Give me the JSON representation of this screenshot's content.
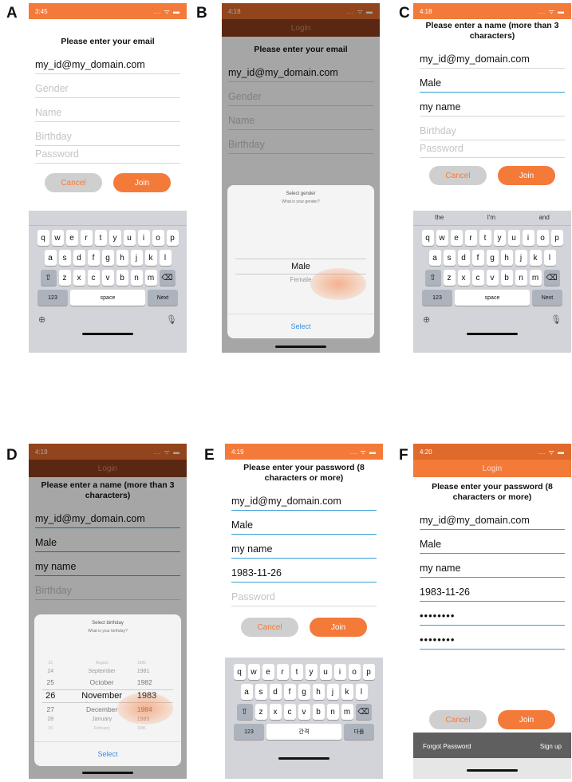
{
  "labels": {
    "a": "A",
    "b": "B",
    "c": "C",
    "d": "D",
    "e": "E",
    "f": "F"
  },
  "status_times": {
    "a": "3:45",
    "b": "4:18",
    "c": "4:18",
    "d": "4:19",
    "e": "4:19",
    "f": "4:20"
  },
  "status_icons": "... ᯤ ▬",
  "nav_title": "Login",
  "prompts": {
    "email": "Please enter your email",
    "name": "Please enter a name (more than 3 characters)",
    "password": "Please enter your password (8 characters or more)"
  },
  "placeholders": {
    "gender": "Gender",
    "name": "Name",
    "birthday": "Birthday",
    "password": "Password"
  },
  "values": {
    "email": "my_id@my_domain.com",
    "gender": "Male",
    "name": "my name",
    "birthday": "1983-11-26",
    "password_mask": "••••••••"
  },
  "buttons": {
    "cancel": "Cancel",
    "join": "Join",
    "select": "Select",
    "forgot": "Forgot Password",
    "signup": "Sign up"
  },
  "gender_picker": {
    "title": "Select gender",
    "subtitle": "What is your gender?",
    "options": [
      "Male",
      "Female"
    ]
  },
  "birthday_picker": {
    "title": "Select birthday",
    "subtitle": "What is your birthday?",
    "days": [
      "23",
      "24",
      "25",
      "26",
      "27",
      "28",
      "29"
    ],
    "months": [
      "August",
      "September",
      "October",
      "November",
      "December",
      "January",
      "February"
    ],
    "years": [
      "1980",
      "1981",
      "1982",
      "1983",
      "1984",
      "1985",
      "1986"
    ]
  },
  "keyboard": {
    "row1": [
      "q",
      "w",
      "e",
      "r",
      "t",
      "y",
      "u",
      "i",
      "o",
      "p"
    ],
    "row2": [
      "a",
      "s",
      "d",
      "f",
      "g",
      "h",
      "j",
      "k",
      "l"
    ],
    "row3": [
      "z",
      "x",
      "c",
      "v",
      "b",
      "n",
      "m"
    ],
    "shift": "⇧",
    "backspace": "⌫",
    "num": "123",
    "space": "space",
    "next": "Next",
    "space_ko": "간격",
    "next_ko": "다음",
    "suggestions": [
      "the",
      "I'm",
      "and"
    ],
    "globe": "⊕",
    "mic": "🎙"
  }
}
